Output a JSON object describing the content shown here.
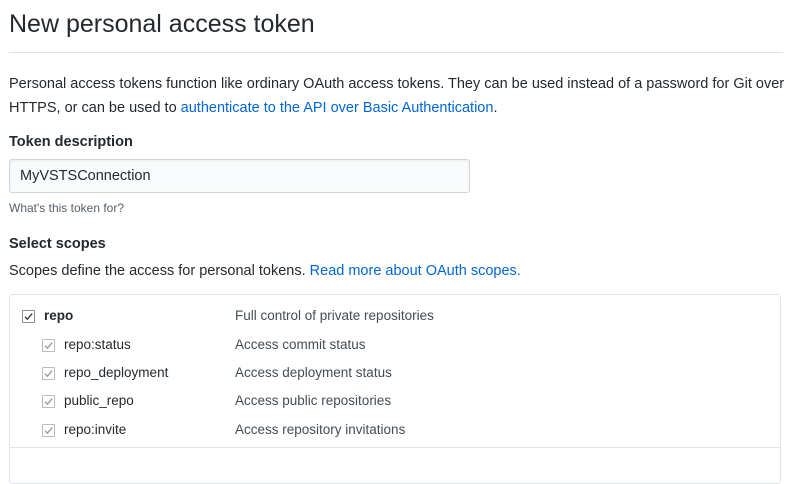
{
  "page": {
    "title": "New personal access token"
  },
  "intro": {
    "text": "Personal access tokens function like ordinary OAuth access tokens. They can be used instead of a password for Git over HTTPS, or can be used to ",
    "link": "authenticate to the API over Basic Authentication",
    "end": "."
  },
  "token_description": {
    "label": "Token description",
    "value": "MyVSTSConnection",
    "hint": "What's this token for?"
  },
  "scopes": {
    "label": "Select scopes",
    "description": "Scopes define the access for personal tokens. ",
    "link": "Read more about OAuth scopes.",
    "items": [
      {
        "name": "repo",
        "description": "Full control of private repositories",
        "checked": true,
        "child": false
      },
      {
        "name": "repo:status",
        "description": "Access commit status",
        "checked": true,
        "child": true
      },
      {
        "name": "repo_deployment",
        "description": "Access deployment status",
        "checked": true,
        "child": true
      },
      {
        "name": "public_repo",
        "description": "Access public repositories",
        "checked": true,
        "child": true
      },
      {
        "name": "repo:invite",
        "description": "Access repository invitations",
        "checked": true,
        "child": true
      }
    ]
  }
}
